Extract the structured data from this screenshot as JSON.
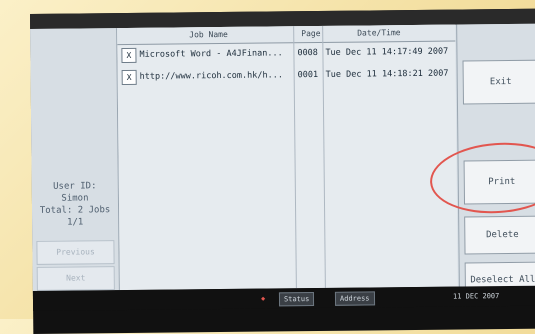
{
  "columns": {
    "job_name": "Job Name",
    "page": "Page",
    "datetime": "Date/Time"
  },
  "jobs": [
    {
      "mark": "X",
      "name": "Microsoft Word - A4JFinan...",
      "pages": "0008",
      "datetime": "Tue Dec 11 14:17:49 2007"
    },
    {
      "mark": "X",
      "name": "http://www.ricoh.com.hk/h...",
      "pages": "0001",
      "datetime": "Tue Dec 11 14:18:21 2007"
    }
  ],
  "left_panel": {
    "user_info": "User ID:\nSimon\nTotal: 2 Jobs\n1/1",
    "previous_label": "Previous",
    "next_label": "Next"
  },
  "right_panel": {
    "exit_label": "Exit",
    "print_label": "Print",
    "delete_label": "Delete",
    "deselect_all_label": "Deselect All"
  },
  "status_bar": {
    "btn1": "Status",
    "btn2": "Address",
    "time": "11 DEC 2007"
  },
  "colors": {
    "highlight_circle": "#e2564f"
  }
}
